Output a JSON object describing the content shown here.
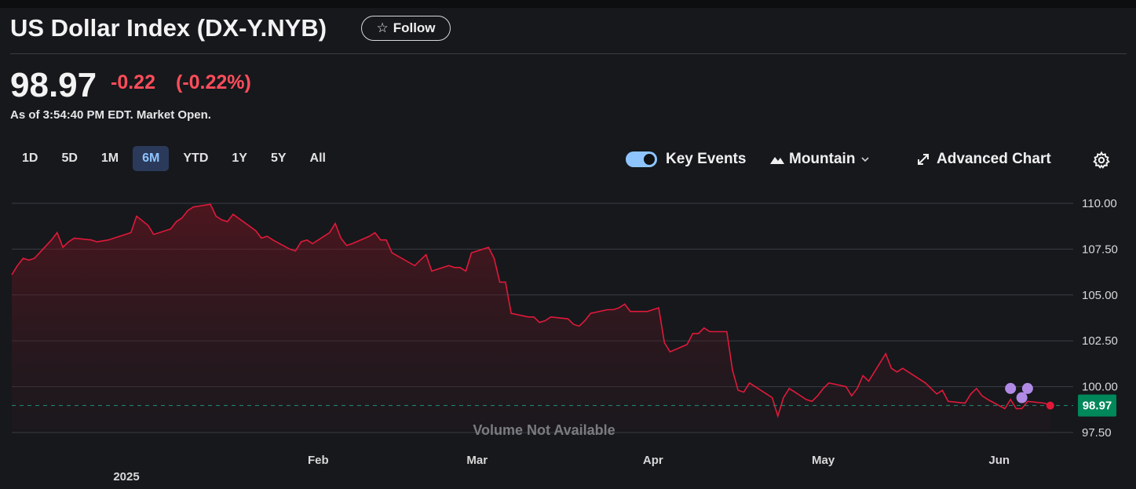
{
  "header": {
    "title": "US Dollar Index (DX-Y.NYB)",
    "follow_label": "Follow",
    "follow_icon": "star-icon",
    "price": "98.97",
    "change": "-0.22",
    "change_pct": "(-0.22%)",
    "as_of": "As of 3:54:40 PM EDT. Market Open.",
    "change_color": "#ff4d5a"
  },
  "toolbar": {
    "ranges": [
      "1D",
      "5D",
      "1M",
      "6M",
      "YTD",
      "1Y",
      "5Y",
      "All"
    ],
    "active_range": "6M",
    "key_events_label": "Key Events",
    "key_events_on": true,
    "chart_type_label": "Mountain",
    "advanced_chart_label": "Advanced Chart"
  },
  "chart_data": {
    "type": "area",
    "title": "",
    "xlabel": "",
    "ylabel": "",
    "ylim": [
      97.5,
      110.0
    ],
    "y_ticks": [
      "110.00",
      "107.50",
      "105.00",
      "102.50",
      "100.00",
      "97.50"
    ],
    "x_ticks": [
      {
        "date": "2025-02-01",
        "label": "Feb"
      },
      {
        "date": "2025-03-01",
        "label": "Mar"
      },
      {
        "date": "2025-04-01",
        "label": "Apr"
      },
      {
        "date": "2025-05-01",
        "label": "May"
      },
      {
        "date": "2025-06-01",
        "label": "Jun"
      }
    ],
    "year_label": "2025",
    "x": [
      "2024-12-09",
      "2024-12-10",
      "2024-12-11",
      "2024-12-12",
      "2024-12-13",
      "2024-12-16",
      "2024-12-17",
      "2024-12-18",
      "2024-12-19",
      "2024-12-20",
      "2024-12-23",
      "2024-12-24",
      "2024-12-26",
      "2024-12-27",
      "2024-12-30",
      "2024-12-31",
      "2025-01-02",
      "2025-01-03",
      "2025-01-06",
      "2025-01-07",
      "2025-01-08",
      "2025-01-09",
      "2025-01-10",
      "2025-01-13",
      "2025-01-14",
      "2025-01-15",
      "2025-01-16",
      "2025-01-17",
      "2025-01-21",
      "2025-01-22",
      "2025-01-23",
      "2025-01-24",
      "2025-01-27",
      "2025-01-28",
      "2025-01-29",
      "2025-01-30",
      "2025-01-31",
      "2025-02-03",
      "2025-02-04",
      "2025-02-05",
      "2025-02-06",
      "2025-02-07",
      "2025-02-10",
      "2025-02-11",
      "2025-02-12",
      "2025-02-13",
      "2025-02-14",
      "2025-02-18",
      "2025-02-19",
      "2025-02-20",
      "2025-02-21",
      "2025-02-24",
      "2025-02-25",
      "2025-02-26",
      "2025-02-27",
      "2025-02-28",
      "2025-03-03",
      "2025-03-04",
      "2025-03-05",
      "2025-03-06",
      "2025-03-07",
      "2025-03-10",
      "2025-03-11",
      "2025-03-12",
      "2025-03-13",
      "2025-03-14",
      "2025-03-17",
      "2025-03-18",
      "2025-03-19",
      "2025-03-20",
      "2025-03-21",
      "2025-03-24",
      "2025-03-25",
      "2025-03-26",
      "2025-03-27",
      "2025-03-28",
      "2025-03-31",
      "2025-04-01",
      "2025-04-02",
      "2025-04-03",
      "2025-04-04",
      "2025-04-07",
      "2025-04-08",
      "2025-04-09",
      "2025-04-10",
      "2025-04-11",
      "2025-04-14",
      "2025-04-15",
      "2025-04-16",
      "2025-04-17",
      "2025-04-18",
      "2025-04-21",
      "2025-04-22",
      "2025-04-23",
      "2025-04-24",
      "2025-04-25",
      "2025-04-28",
      "2025-04-29",
      "2025-04-30",
      "2025-05-01",
      "2025-05-02",
      "2025-05-05",
      "2025-05-06",
      "2025-05-07",
      "2025-05-08",
      "2025-05-09",
      "2025-05-12",
      "2025-05-13",
      "2025-05-14",
      "2025-05-15",
      "2025-05-16",
      "2025-05-19",
      "2025-05-20",
      "2025-05-21",
      "2025-05-22",
      "2025-05-23",
      "2025-05-26",
      "2025-05-27",
      "2025-05-28",
      "2025-05-29",
      "2025-05-30",
      "2025-06-02",
      "2025-06-03",
      "2025-06-04",
      "2025-06-05",
      "2025-06-06",
      "2025-06-09",
      "2025-06-10",
      "2025-06-11"
    ],
    "series": [
      {
        "values": [
          106.1,
          106.6,
          107.0,
          106.9,
          107.0,
          108.0,
          108.4,
          107.6,
          107.9,
          108.1,
          108.0,
          107.9,
          108.0,
          108.1,
          108.4,
          109.3,
          108.8,
          108.3,
          108.6,
          109.0,
          109.2,
          109.6,
          109.8,
          109.95,
          109.3,
          109.1,
          109.0,
          109.4,
          108.5,
          108.1,
          108.2,
          108.0,
          107.5,
          107.4,
          107.9,
          108.0,
          107.8,
          108.4,
          108.9,
          108.1,
          107.7,
          107.8,
          108.2,
          108.4,
          108.0,
          108.0,
          107.3,
          106.6,
          106.9,
          107.2,
          106.3,
          106.6,
          106.5,
          106.5,
          106.3,
          107.3,
          107.6,
          107.0,
          105.7,
          105.7,
          104.0,
          103.8,
          103.8,
          103.5,
          103.6,
          103.8,
          103.7,
          103.4,
          103.3,
          103.6,
          104.0,
          104.2,
          104.2,
          104.3,
          104.5,
          104.1,
          104.1,
          104.2,
          104.3,
          102.4,
          101.9,
          102.3,
          102.9,
          102.9,
          103.2,
          103.0,
          103.0,
          100.9,
          99.8,
          99.7,
          100.2,
          99.6,
          99.4,
          98.4,
          99.4,
          99.9,
          99.3,
          99.2,
          99.5,
          99.9,
          100.2,
          100.0,
          99.5,
          99.9,
          100.6,
          100.3,
          101.8,
          101.0,
          100.8,
          101.0,
          100.8,
          100.2,
          99.9,
          99.6,
          99.8,
          99.2,
          99.1,
          99.6,
          99.9,
          99.5,
          99.3,
          98.8,
          99.3,
          98.8,
          98.8,
          99.2,
          99.1,
          98.97
        ]
      }
    ],
    "last_value_label": "98.97",
    "last_value_color": "#00875a",
    "line_color": "#e0193a",
    "baseline_color": "#1e8f78",
    "volume_text": "Volume Not Available",
    "event_markers": [
      {
        "date": "2025-06-03",
        "value": 99.9
      },
      {
        "date": "2025-06-05",
        "value": 99.4
      },
      {
        "date": "2025-06-06",
        "value": 99.9
      }
    ],
    "event_color": "#b18ae6",
    "grid": true
  }
}
